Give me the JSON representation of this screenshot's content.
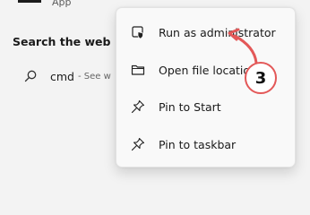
{
  "app": {
    "type_label": "App"
  },
  "search_web": {
    "title": "Search the web",
    "query": "cmd",
    "suffix": "- See w"
  },
  "context_menu": {
    "items": [
      {
        "label": "Run as administrator",
        "icon": "shield-icon"
      },
      {
        "label": "Open file location",
        "icon": "folder-icon"
      },
      {
        "label": "Pin to Start",
        "icon": "pin-icon"
      },
      {
        "label": "Pin to taskbar",
        "icon": "pin-icon"
      }
    ]
  },
  "annotation": {
    "step": "3",
    "color": "#e35858"
  }
}
